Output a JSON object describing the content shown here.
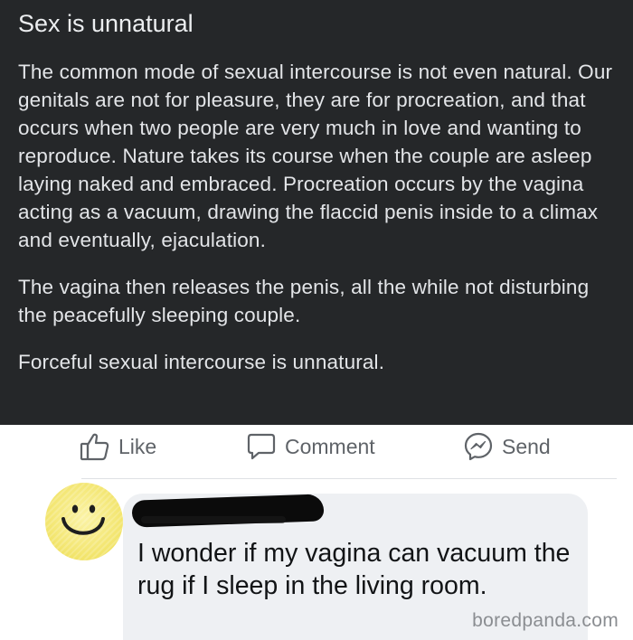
{
  "post": {
    "title": "Sex is unnatural",
    "paragraphs": [
      "The common mode of sexual intercourse is not even natural. Our genitals are not for pleasure, they are for procreation, and that occurs when two people are very much in love and wanting to reproduce. Nature takes its course when the couple are asleep laying naked and embraced. Procreation occurs by the vagina acting as a vacuum, drawing the flaccid penis inside to a climax and eventually, ejaculation.",
      "The vagina then releases the penis, all the while not disturbing the peacefully sleeping couple.",
      "Forceful sexual intercourse is unnatural."
    ],
    "background": "#252729",
    "text_color": "#e3e5e8"
  },
  "actions": {
    "like": {
      "label": "Like",
      "icon": "thumbs-up-icon"
    },
    "comment": {
      "label": "Comment",
      "icon": "speech-bubble-icon"
    },
    "send": {
      "label": "Send",
      "icon": "messenger-icon"
    }
  },
  "comment": {
    "avatar": "smiley-face-icon",
    "author_redacted": true,
    "text": "I wonder if my vagina can vacuum the rug if I sleep in the living room."
  },
  "watermark": "boredpanda.com"
}
